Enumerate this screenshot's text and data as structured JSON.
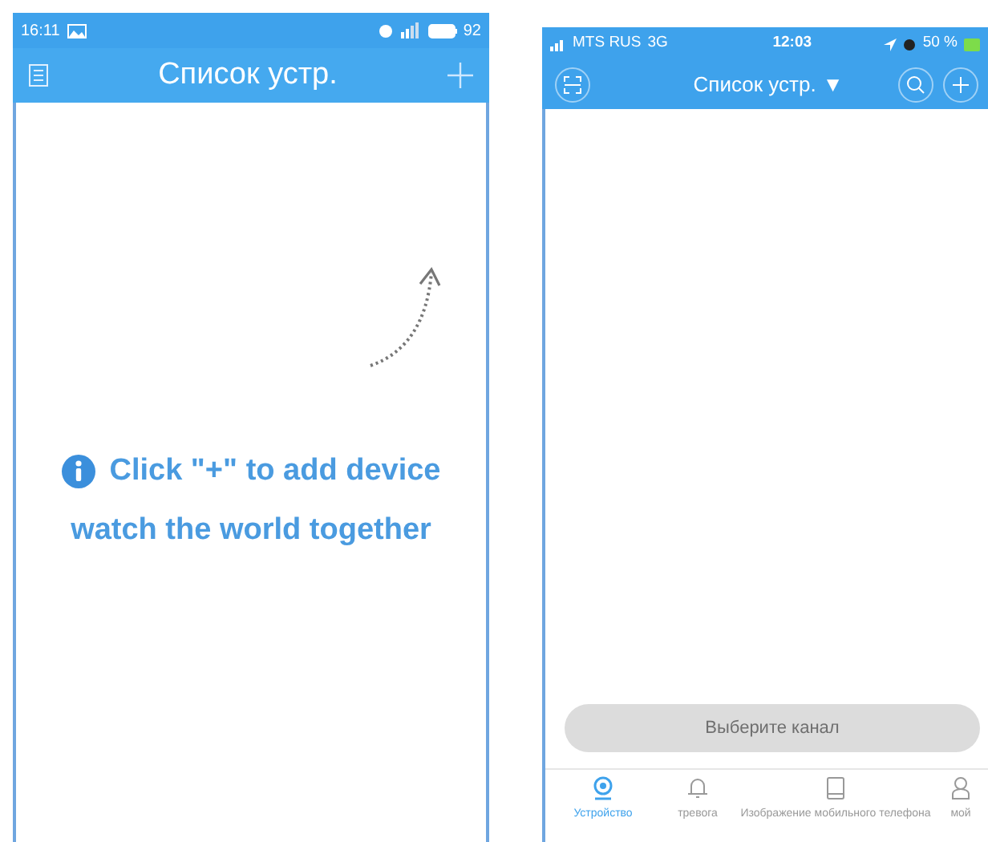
{
  "left_phone": {
    "status_bar": {
      "time": "16:11",
      "battery": "92"
    },
    "header": {
      "title": "Список устр."
    },
    "empty_state": {
      "lines": [
        "Click \"+\" to add device",
        "watch the world together"
      ]
    }
  },
  "right_phone": {
    "status_bar": {
      "carrier": "MTS RUS",
      "network": "3G",
      "time": "12:03",
      "battery": "50 %"
    },
    "header": {
      "title": "Список устр.",
      "dropdown": "▼"
    },
    "select_button": {
      "label": "Выберите канал",
      "disabled": true
    },
    "tab_bar": [
      {
        "label": "Устройство",
        "selected": true
      },
      {
        "label": "тревога",
        "selected": false
      },
      {
        "label": "Изображение мобильного телефона",
        "selected": false
      },
      {
        "label": "мой",
        "selected": false
      }
    ]
  }
}
